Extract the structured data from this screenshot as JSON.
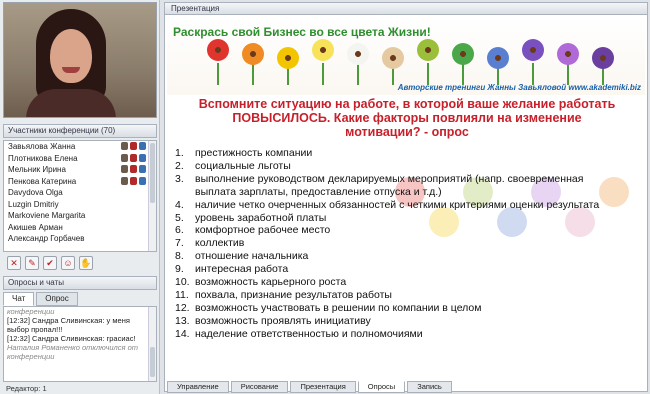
{
  "participants": {
    "title": "Участники конференции (70)",
    "list": [
      "Завьялова Жанна",
      "Плотникова Елена",
      "Мельник Ирина",
      "Пенкова Катерина",
      "Davydova Olga",
      "Luzgin Dmitriy",
      "Markoviene Margarita",
      "Акишев Арман",
      "Александр Горбачев"
    ]
  },
  "left_toolbar": [
    "✕",
    "✎",
    "✔",
    "☺",
    "✋"
  ],
  "chat_panel": {
    "title": "Опросы и чаты",
    "tabs": [
      "Чат",
      "Опрос"
    ],
    "messages": [
      {
        "text": "конференции",
        "sys": true
      },
      {
        "text": "[12:32] Сандра Сливинская: у меня выбор пропал!!!",
        "sys": false
      },
      {
        "text": "[12:32] Сандра Сливинская: грасиас!",
        "sys": false
      },
      {
        "text": "Наталия Романенко отключился от конференции",
        "sys": true
      }
    ],
    "input": "Редактор: 1"
  },
  "presentation": {
    "panel_title": "Презентация",
    "banner_title": "Раскрась свой Бизнес во все цвета Жизни!",
    "banner_credit": "Авторские тренинги Жанны Завьяловой www.akademiki.biz",
    "heading": "Вспомните ситуацию на работе, в которой ваше желание работать ПОВЫСИЛОСЬ. Какие факторы повлияли на изменение мотивации? - опрос",
    "items": [
      {
        "num": "1.",
        "text": "престижность компании"
      },
      {
        "num": "2.",
        "text": "социальные льготы"
      },
      {
        "num": "3.",
        "text": "выполнение руководством декларируемых мероприятий (напр. своевременная выплата зарплаты, предоставление отпуска и т.д.)"
      },
      {
        "num": "4.",
        "text": "наличие четко очерченных обязанностей с четкими критериями оценки результата"
      },
      {
        "num": "5.",
        "text": "уровень заработной платы"
      },
      {
        "num": "6.",
        "text": "комфортное рабочее место"
      },
      {
        "num": "7.",
        "text": "коллектив"
      },
      {
        "num": "8.",
        "text": "отношение начальника"
      },
      {
        "num": "9.",
        "text": "интересная работа"
      },
      {
        "num": "10.",
        "text": "возможность карьерного роста"
      },
      {
        "num": "11.",
        "text": "похвала, признание результатов работы"
      },
      {
        "num": "12.",
        "text": "возможность участвовать в решении по компании в целом"
      },
      {
        "num": "13.",
        "text": "возможность проявлять инициативу"
      },
      {
        "num": "14.",
        "text": "наделение ответственностью и полномочиями"
      }
    ]
  },
  "bottom_tabs": [
    "Управление",
    "Рисование",
    "Презентация",
    "Опросы",
    "Запись"
  ],
  "active_bottom_tab": "Опросы",
  "colors": {
    "heading": "#c8202a",
    "banner_title": "#2f8f2f",
    "credit": "#1a5fa8"
  }
}
